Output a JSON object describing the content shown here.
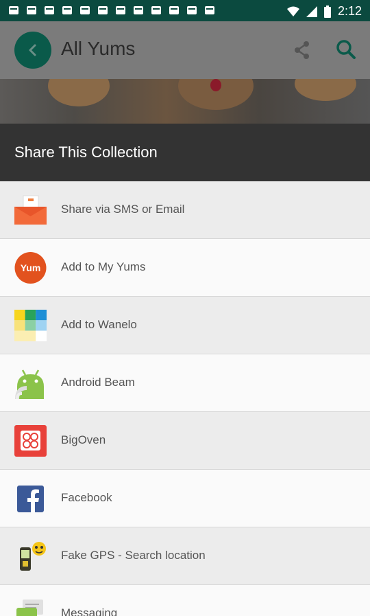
{
  "status_bar": {
    "time": "2:12"
  },
  "app_bar": {
    "title": "All Yums"
  },
  "sheet": {
    "title": "Share This Collection",
    "items": [
      {
        "label": "Share via SMS or Email",
        "icon": "mail-icon"
      },
      {
        "label": "Add to My Yums",
        "icon": "yum-icon"
      },
      {
        "label": "Add to Wanelo",
        "icon": "wanelo-icon"
      },
      {
        "label": "Android Beam",
        "icon": "android-icon"
      },
      {
        "label": "BigOven",
        "icon": "bigoven-icon"
      },
      {
        "label": "Facebook",
        "icon": "facebook-icon"
      },
      {
        "label": "Fake GPS - Search location",
        "icon": "gps-icon"
      },
      {
        "label": "Messaging",
        "icon": "messaging-icon"
      }
    ]
  },
  "colors": {
    "status_bar": "#0b4a3f",
    "back_button": "#0a5a4a",
    "sheet_header": "#333333",
    "accent": "#0a6a58"
  }
}
